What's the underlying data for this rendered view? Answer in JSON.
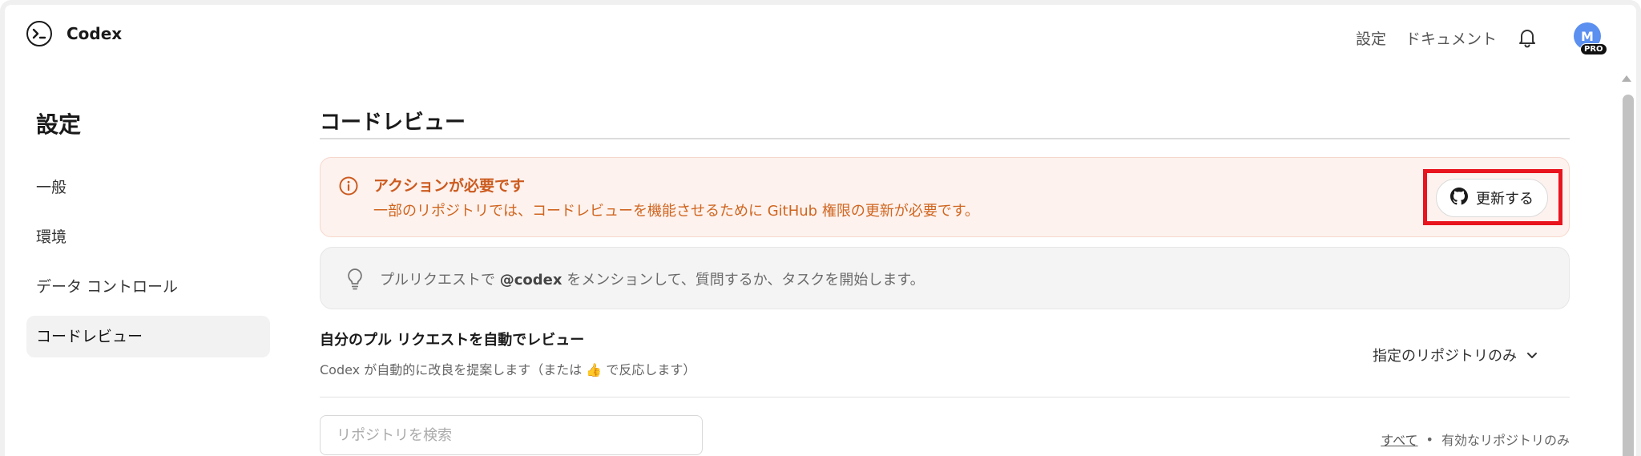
{
  "app": {
    "name": "Codex"
  },
  "header": {
    "settings_link": "設定",
    "docs_link": "ドキュメント",
    "avatar_initial": "M",
    "plan_badge": "PRO",
    "avatar_color": "#5b8ff0"
  },
  "sidebar": {
    "title": "設定",
    "items": [
      {
        "label": "一般",
        "active": false
      },
      {
        "label": "環境",
        "active": false
      },
      {
        "label": "データ コントロール",
        "active": false
      },
      {
        "label": "コードレビュー",
        "active": true
      }
    ]
  },
  "main": {
    "title": "コードレビュー",
    "alert": {
      "icon": "info-icon",
      "title": "アクションが必要です",
      "description": "一部のリポジトリでは、コードレビューを機能させるために GitHub 権限の更新が必要です。",
      "button_label": "更新する",
      "button_icon": "github-icon",
      "accent_color": "#cc5b1f"
    },
    "tip": {
      "icon": "lightbulb-icon",
      "text_before": "プルリクエストで ",
      "mention": "@codex",
      "text_after": " をメンションして、質問するか、タスクを開始します。"
    },
    "auto_review": {
      "title": "自分のプル リクエストを自動でレビュー",
      "description_before": "Codex が自動的に改良を提案します（または ",
      "description_emoji": "👍",
      "description_after": " で反応します）",
      "select_value": "指定のリポジトリのみ"
    },
    "repo_search": {
      "placeholder": "リポジトリを検索",
      "filter_all": "すべて",
      "filter_separator": "•",
      "filter_active": "有効なリポジトリのみ"
    }
  }
}
